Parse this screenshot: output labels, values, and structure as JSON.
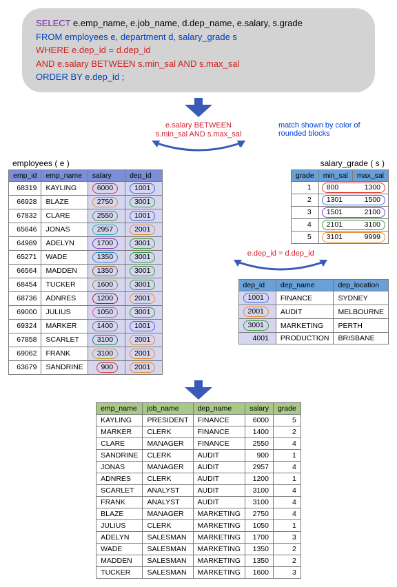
{
  "sql": {
    "line1_pre": "SELECT ",
    "line1_cols": "e.emp_name,  e.job_name, d.dep_name, e.salary, s.grade",
    "line2": "FROM employees e, department d, salary_grade s",
    "line3": "WHERE e.dep_id = d.dep_id",
    "line4": "AND e.salary BETWEEN s.min_sal AND s.max_sal",
    "line5": "ORDER BY e.dep_id ;"
  },
  "note_match": "match shown by color of rounded blocks",
  "labels": {
    "employees": "employees ( e )",
    "salary_grade": "salary_grade ( s )",
    "join_salary": "e.salary BETWEEN\ns.min_sal AND s.max_sal",
    "join_dep": "e.dep_id = d.dep_id"
  },
  "employees": {
    "headers": [
      "emp_id",
      "emp_name",
      "salary",
      "dep_id"
    ],
    "rows": [
      {
        "emp_id": 68319,
        "emp_name": "KAYLING",
        "salary": 6000,
        "dep_id": 1001,
        "sc": "c-red",
        "dc": "c-blue"
      },
      {
        "emp_id": 66928,
        "emp_name": "BLAZE",
        "salary": 2750,
        "dep_id": 3001,
        "sc": "c-orange",
        "dc": "c-green"
      },
      {
        "emp_id": 67832,
        "emp_name": "CLARE",
        "salary": 2550,
        "dep_id": 1001,
        "sc": "c-green",
        "dc": "c-blue"
      },
      {
        "emp_id": 65646,
        "emp_name": "JONAS",
        "salary": 2957,
        "dep_id": 2001,
        "sc": "c-teal",
        "dc": "c-orange"
      },
      {
        "emp_id": 64989,
        "emp_name": "ADELYN",
        "salary": 1700,
        "dep_id": 3001,
        "sc": "c-purple",
        "dc": "c-green"
      },
      {
        "emp_id": 65271,
        "emp_name": "WADE",
        "salary": 1350,
        "dep_id": 3001,
        "sc": "c-cyan",
        "dc": "c-green"
      },
      {
        "emp_id": 66564,
        "emp_name": "MADDEN",
        "salary": 1350,
        "dep_id": 3001,
        "sc": "c-brown",
        "dc": "c-green"
      },
      {
        "emp_id": 68454,
        "emp_name": "TUCKER",
        "salary": 1600,
        "dep_id": 3001,
        "sc": "c-olive",
        "dc": "c-green"
      },
      {
        "emp_id": 68736,
        "emp_name": "ADNRES",
        "salary": 1200,
        "dep_id": 2001,
        "sc": "c-dkred",
        "dc": "c-orange"
      },
      {
        "emp_id": 69000,
        "emp_name": "JULIUS",
        "salary": 1050,
        "dep_id": 3001,
        "sc": "c-pink",
        "dc": "c-green"
      },
      {
        "emp_id": 69324,
        "emp_name": "MARKER",
        "salary": 1400,
        "dep_id": 1001,
        "sc": "c-gray",
        "dc": "c-blue"
      },
      {
        "emp_id": 67858,
        "emp_name": "SCARLET",
        "salary": 3100,
        "dep_id": 2001,
        "sc": "c-dkgrn",
        "dc": "c-orange"
      },
      {
        "emp_id": 69062,
        "emp_name": "FRANK",
        "salary": 3100,
        "dep_id": 2001,
        "sc": "c-yellow",
        "dc": "c-orange"
      },
      {
        "emp_id": 63679,
        "emp_name": "SANDRINE",
        "salary": 900,
        "dep_id": 2001,
        "sc": "c-red",
        "dc": "c-orange"
      }
    ]
  },
  "salary_grade": {
    "headers": [
      "grade",
      "min_sal",
      "max_sal"
    ],
    "rows": [
      {
        "grade": 1,
        "min_sal": 800,
        "max_sal": 1300,
        "c": "c-red"
      },
      {
        "grade": 2,
        "min_sal": 1301,
        "max_sal": 1500,
        "c": "c-blue"
      },
      {
        "grade": 3,
        "min_sal": 1501,
        "max_sal": 2100,
        "c": "c-purple"
      },
      {
        "grade": 4,
        "min_sal": 2101,
        "max_sal": 3100,
        "c": "c-green"
      },
      {
        "grade": 5,
        "min_sal": 3101,
        "max_sal": 9999,
        "c": "c-orange"
      }
    ]
  },
  "department": {
    "headers": [
      "dep_id",
      "dep_name",
      "dep_location"
    ],
    "rows": [
      {
        "dep_id": 1001,
        "dep_name": "FINANCE",
        "dep_location": "SYDNEY",
        "c": "c-blue"
      },
      {
        "dep_id": 2001,
        "dep_name": "AUDIT",
        "dep_location": "MELBOURNE",
        "c": "c-orange"
      },
      {
        "dep_id": 3001,
        "dep_name": "MARKETING",
        "dep_location": "PERTH",
        "c": "c-green"
      },
      {
        "dep_id": 4001,
        "dep_name": "PRODUCTION",
        "dep_location": "BRISBANE",
        "c": ""
      }
    ]
  },
  "result": {
    "headers": [
      "emp_name",
      "job_name",
      "dep_name",
      "salary",
      "grade"
    ],
    "rows": [
      [
        "KAYLING",
        "PRESIDENT",
        "FINANCE",
        6000,
        5
      ],
      [
        "MARKER",
        "CLERK",
        "FINANCE",
        1400,
        2
      ],
      [
        "CLARE",
        "MANAGER",
        "FINANCE",
        2550,
        4
      ],
      [
        "SANDRINE",
        "CLERK",
        "AUDIT",
        900,
        1
      ],
      [
        "JONAS",
        "MANAGER",
        "AUDIT",
        2957,
        4
      ],
      [
        "ADNRES",
        "CLERK",
        "AUDIT",
        1200,
        1
      ],
      [
        "SCARLET",
        "ANALYST",
        "AUDIT",
        3100,
        4
      ],
      [
        "FRANK",
        "ANALYST",
        "AUDIT",
        3100,
        4
      ],
      [
        "BLAZE",
        "MANAGER",
        "MARKETING",
        2750,
        4
      ],
      [
        "JULIUS",
        "CLERK",
        "MARKETING",
        1050,
        1
      ],
      [
        "ADELYN",
        "SALESMAN",
        "MARKETING",
        1700,
        3
      ],
      [
        "WADE",
        "SALESMAN",
        "MARKETING",
        1350,
        2
      ],
      [
        "MADDEN",
        "SALESMAN",
        "MARKETING",
        1350,
        2
      ],
      [
        "TUCKER",
        "SALESMAN",
        "MARKETING",
        1600,
        3
      ]
    ]
  }
}
